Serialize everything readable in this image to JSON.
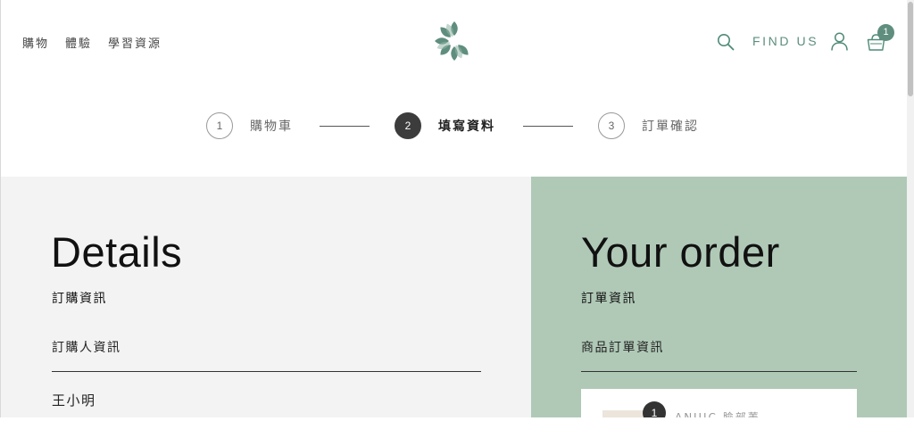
{
  "nav": {
    "left_items": [
      "購物",
      "體驗",
      "學習資源"
    ],
    "find_us": "FIND US",
    "cart_count": "1"
  },
  "stepper": {
    "steps": [
      {
        "number": "1",
        "label": "購物車"
      },
      {
        "number": "2",
        "label": "填寫資料"
      },
      {
        "number": "3",
        "label": "訂單確認"
      }
    ],
    "active_step": 2
  },
  "details": {
    "title": "Details",
    "section": "訂購資訊",
    "subsection": "訂購人資訊",
    "name": "王小明"
  },
  "order": {
    "title": "Your order",
    "section": "訂單資訊",
    "subsection": "商品訂單資訊",
    "item_qty": "1",
    "item_name": "ANUIC 臉部菁"
  },
  "colors": {
    "brand_green": "#5f8e7e",
    "order_panel": "#b0c9b7",
    "details_panel": "#f3f3f3"
  }
}
